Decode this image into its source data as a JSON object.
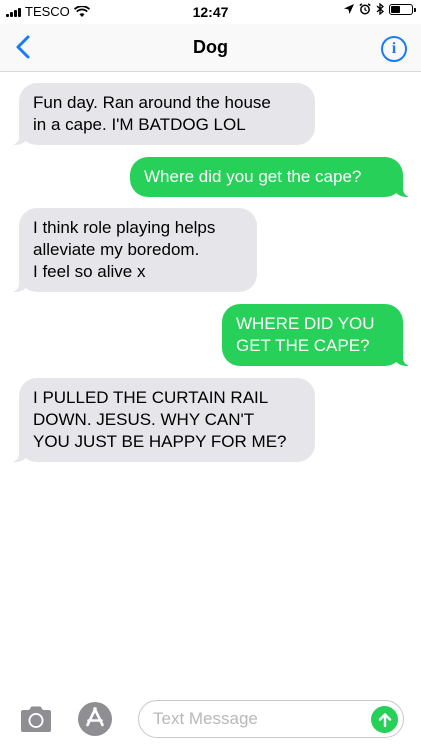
{
  "status_bar": {
    "carrier": "TESCO",
    "time": "12:47",
    "battery_level": 0.45
  },
  "nav": {
    "title": "Dog",
    "info_glyph": "i"
  },
  "messages": [
    {
      "direction": "incoming",
      "text": "Fun day. Ran around the house\nin a cape. I'M BATDOG LOL"
    },
    {
      "direction": "outgoing",
      "text": "Where did you get the cape?"
    },
    {
      "direction": "incoming",
      "text": "I think role playing helps\nalleviate my boredom.\nI feel so alive x"
    },
    {
      "direction": "outgoing",
      "text": "WHERE DID YOU\nGET THE CAPE?"
    },
    {
      "direction": "incoming",
      "text": "I PULLED THE CURTAIN RAIL\nDOWN. JESUS. WHY CAN'T\nYOU JUST BE HAPPY FOR ME?"
    }
  ],
  "composer": {
    "placeholder": "Text Message",
    "value": ""
  },
  "colors": {
    "accent_blue": "#1a7cf5",
    "outgoing_bubble": "#27d058",
    "incoming_bubble": "#e5e5ea"
  },
  "icons": {
    "back": "chevron-left-icon",
    "info": "info-icon",
    "camera": "camera-icon",
    "app_store": "app-store-icon",
    "send": "arrow-up-icon"
  }
}
